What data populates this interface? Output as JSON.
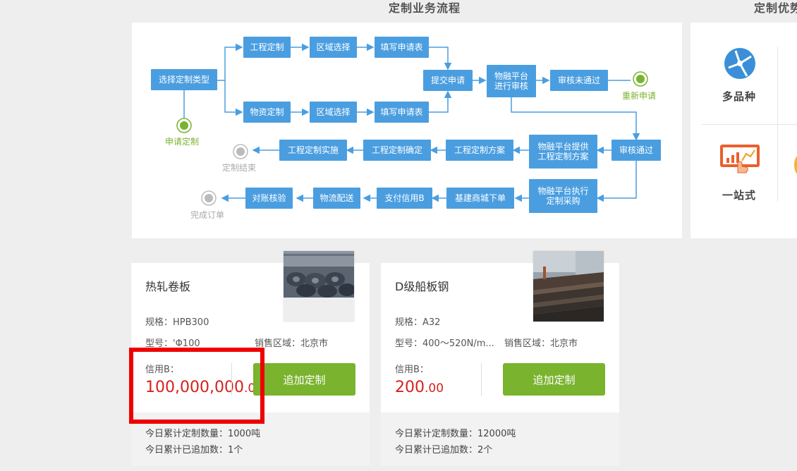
{
  "process": {
    "title": "定制业务流程",
    "nodes": {
      "select_type": "选择定制类型",
      "engineering_custom": "工程定制",
      "region_select_1": "区域选择",
      "fill_form_1": "填写申请表",
      "material_custom": "物资定制",
      "region_select_2": "区域选择",
      "fill_form_2": "填写申请表",
      "submit": "提交申请",
      "platform_review": "物融平台进行审核",
      "review_failed": "审核未通过",
      "review_passed": "审核通过",
      "platform_plan": "物融平台提供工程定制方案",
      "eng_plan": "工程定制方案",
      "eng_confirm": "工程定制确定",
      "eng_implement": "工程定制实施",
      "platform_purchase": "物融平台执行定制采购",
      "order": "基建商城下单",
      "pay": "支付信用B",
      "delivery": "物流配送",
      "reconcile": "对账核验"
    },
    "endpoints": {
      "apply": "申请定制",
      "reapply": "重新申请",
      "end": "定制结束",
      "complete": "完成订单"
    }
  },
  "advantages": {
    "title": "定制优势",
    "items": [
      "多品种",
      "一站式"
    ]
  },
  "products": [
    {
      "name": "热轧卷板",
      "spec": "规格：HPB300",
      "model": "型号：'Φ100",
      "region": "销售区域：北京市",
      "credit_label": "信用B：",
      "price_int": "100,000,000",
      "price_dec": ".00",
      "button": "追加定制",
      "today_qty": "今日累计定制数量：1000吨",
      "today_adds": "今日累计已追加数：1个"
    },
    {
      "name": "D级船板钢",
      "spec": "规格：A32",
      "model": "型号：400～520N/m...",
      "region": "销售区域：北京市",
      "credit_label": "信用B：",
      "price_int": "200",
      "price_dec": ".00",
      "button": "追加定制",
      "today_qty": "今日累计定制数量：12000吨",
      "today_adds": "今日累计已追加数：2个"
    }
  ],
  "colors": {
    "node_blue": "#4a9ee0",
    "accent_green": "#7ab32e",
    "price_red": "#d7201d",
    "highlight_red": "#ee0000"
  }
}
